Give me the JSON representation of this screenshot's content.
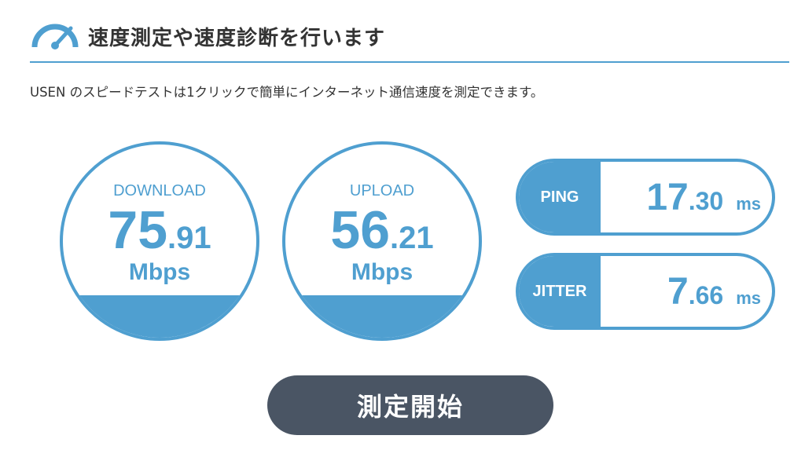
{
  "header": {
    "title": "速度測定や速度診断を行います",
    "icon": "speedometer-icon"
  },
  "intro": "USEN のスピードテストは1クリックで簡単にインターネット通信速度を測定できます。",
  "download": {
    "label": "DOWNLOAD",
    "value_int": "75",
    "value_dec": ".91",
    "unit": "Mbps"
  },
  "upload": {
    "label": "UPLOAD",
    "value_int": "56",
    "value_dec": ".21",
    "unit": "Mbps"
  },
  "ping": {
    "label": "PING",
    "value_int": "17",
    "value_dec": ".30",
    "unit": "ms"
  },
  "jitter": {
    "label": "JITTER",
    "value_int": "7",
    "value_dec": ".66",
    "unit": "ms"
  },
  "start_button": {
    "label": "測定開始"
  },
  "colors": {
    "accent": "#4f9fd0",
    "button": "#4a5564",
    "text": "#333333"
  }
}
